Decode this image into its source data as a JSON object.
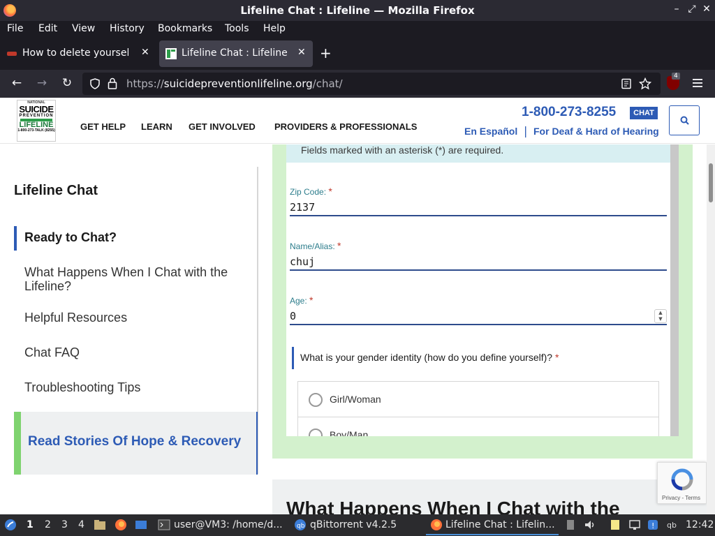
{
  "window": {
    "title": "Lifeline Chat : Lifeline — Mozilla Firefox",
    "controls": {
      "minimize": "–",
      "restore": "⤢",
      "close": "✕"
    }
  },
  "menubar": [
    "File",
    "Edit",
    "View",
    "History",
    "Bookmarks",
    "Tools",
    "Help"
  ],
  "tabs": [
    {
      "label": "How to delete yourself fr",
      "favicon": "red-site-icon",
      "active": false,
      "close": "✕"
    },
    {
      "label": "Lifeline Chat : Lifeline",
      "favicon": "lifeline-icon",
      "active": true,
      "close": "✕"
    }
  ],
  "newtab": "+",
  "navbar": {
    "back": "←",
    "forward": "→",
    "reload": "↻",
    "url_prefix": "https://",
    "url_host": "suicidepreventionlifeline.org",
    "url_path": "/chat/",
    "extension_badge": "4"
  },
  "site": {
    "logo": {
      "line1": "NATIONAL",
      "line2": "SUICIDE",
      "line3": "PREVENTION",
      "line4": "LIFELINE",
      "line5": "1-800-273-TALK (8255)"
    },
    "nav": [
      "GET HELP",
      "LEARN",
      "GET INVOLVED",
      "PROVIDERS & PROFESSIONALS"
    ],
    "phone": "1-800-273-8255",
    "chat_label": "CHAT",
    "espanol": "En Español",
    "separator": "|",
    "deaf_link": "For Deaf & Hard of Hearing"
  },
  "sidebar": {
    "title": "Lifeline Chat",
    "items": [
      {
        "label": "Ready to Chat?",
        "active": true
      },
      {
        "label": "What Happens When I Chat with the Lifeline?",
        "active": false
      },
      {
        "label": "Helpful Resources",
        "active": false
      },
      {
        "label": "Chat FAQ",
        "active": false
      },
      {
        "label": "Troubleshooting Tips",
        "active": false
      }
    ],
    "stories": "Read Stories Of Hope & Recovery"
  },
  "form": {
    "notice": "Fields marked with an asterisk (*) are required.",
    "required_mark": "*",
    "zip": {
      "label": "Zip Code:",
      "value": "2137"
    },
    "name": {
      "label": "Name/Alias:",
      "value": "chuj"
    },
    "age": {
      "label": "Age:",
      "value": "0"
    },
    "gender_question": "What is your gender identity (how do you define yourself)?",
    "gender_options": [
      "Girl/Woman",
      "Boy/Man"
    ]
  },
  "lower_heading": "What Happens When I Chat with the",
  "recaptcha": {
    "text": "Privacy - Terms"
  },
  "taskbar": {
    "workspaces": [
      "1",
      "2",
      "3",
      "4"
    ],
    "terminal": "user@VM3: /home/d...",
    "qbittorrent": "qBittorrent v4.2.5",
    "firefox": "Lifeline Chat : Lifelin...",
    "clock": "12:42"
  }
}
